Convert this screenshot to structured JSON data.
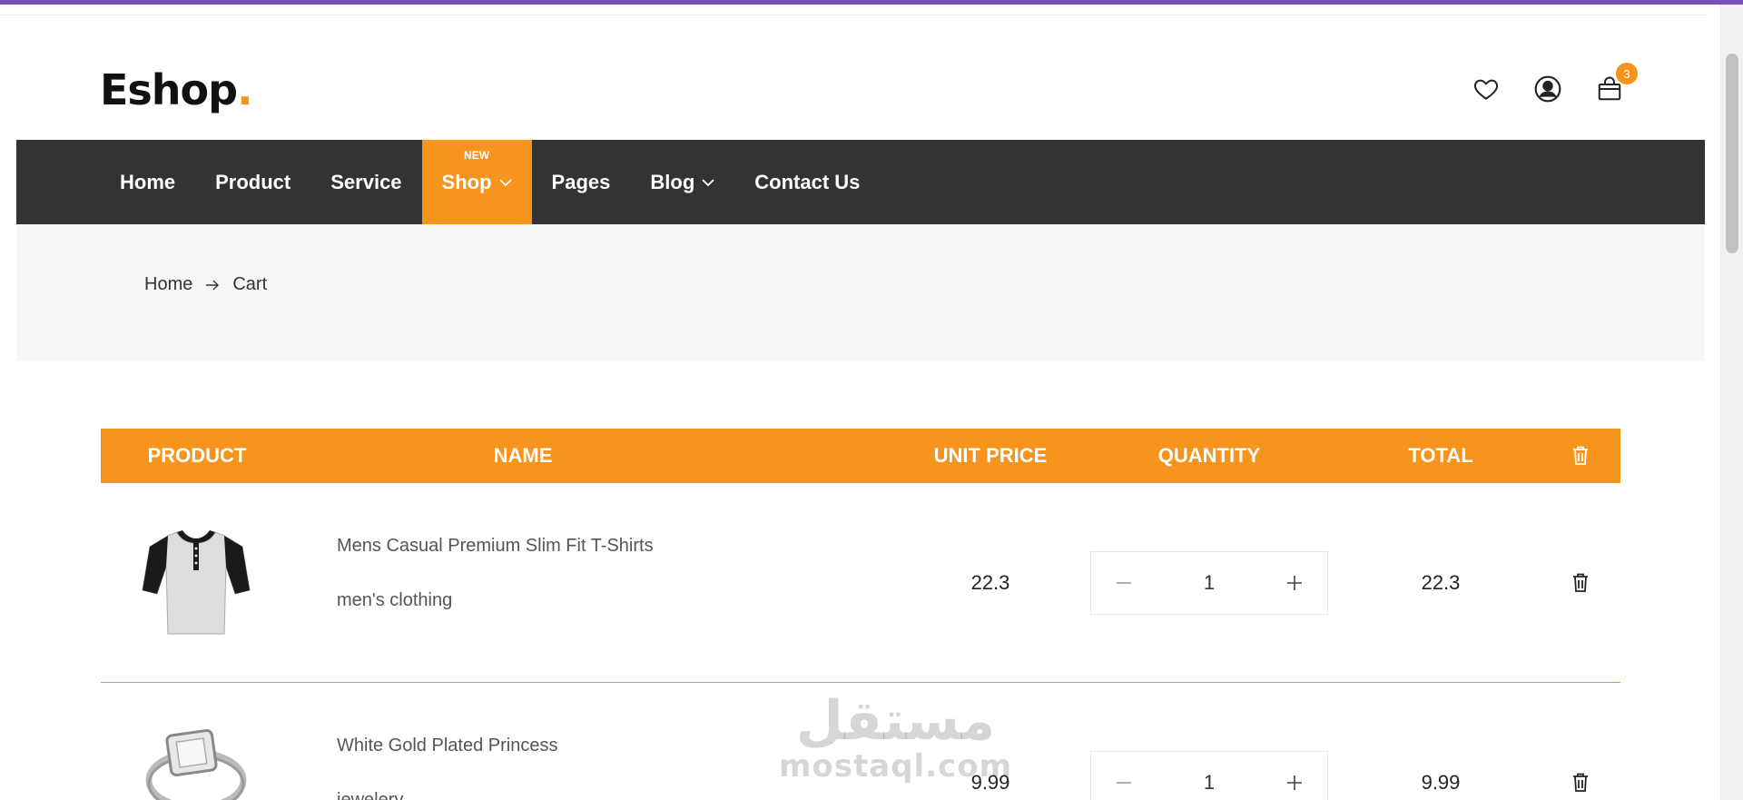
{
  "header": {
    "logo_text": "Eshop",
    "logo_dot": ".",
    "cart_count": "3"
  },
  "nav": {
    "items": [
      {
        "label": "Home"
      },
      {
        "label": "Product"
      },
      {
        "label": "Service"
      },
      {
        "label": "Shop",
        "tag": "NEW"
      },
      {
        "label": "Pages"
      },
      {
        "label": "Blog"
      },
      {
        "label": "Contact Us"
      }
    ]
  },
  "breadcrumb": {
    "home": "Home",
    "current": "Cart"
  },
  "cart": {
    "headers": {
      "product": "PRODUCT",
      "name": "NAME",
      "unit_price": "UNIT PRICE",
      "quantity": "QUANTITY",
      "total": "TOTAL"
    },
    "rows": [
      {
        "name": "Mens Casual Premium Slim Fit T-Shirts",
        "category": "men's clothing",
        "unit_price": "22.3",
        "quantity": "1",
        "total": "22.3"
      },
      {
        "name": "White Gold Plated Princess",
        "category": "jewelery",
        "unit_price": "9.99",
        "quantity": "1",
        "total": "9.99"
      }
    ]
  },
  "watermark": {
    "arabic": "مستقل",
    "latin": "mostaql.com"
  },
  "colors": {
    "accent": "#f7941d",
    "nav_bg": "#333333",
    "top_bar": "#7b4fb8",
    "breadcrumb_bg": "#f5f6f8"
  },
  "icons": [
    "heart-icon",
    "user-icon",
    "shopping-bag-icon",
    "chevron-down-icon",
    "arrow-right-icon",
    "trash-icon",
    "minus-icon",
    "plus-icon"
  ]
}
